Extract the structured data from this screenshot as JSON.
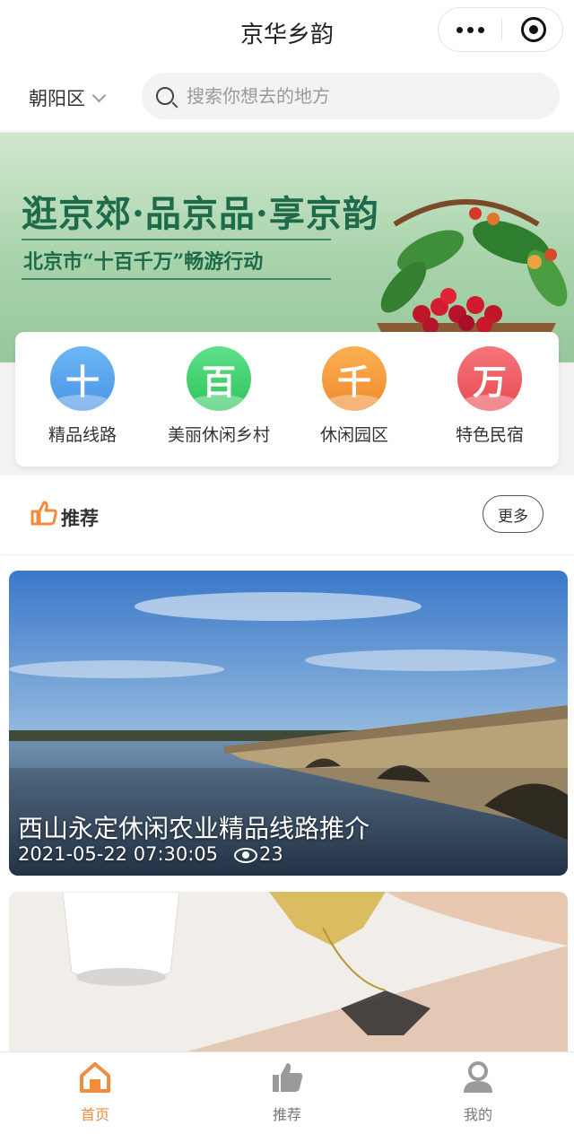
{
  "app": {
    "title": "京华乡韵"
  },
  "location": {
    "district": "朝阳区"
  },
  "search": {
    "placeholder": "搜索你想去的地方"
  },
  "banner": {
    "title": "逛京郊·品京品·享京韵",
    "subtitle": "北京市“十百千万”畅游行动"
  },
  "quick_links": [
    {
      "label": "精品线路",
      "glyph": "十",
      "color": "#5aa7f0"
    },
    {
      "label": "美丽休闲乡村",
      "glyph": "百",
      "color": "#3fcf6a"
    },
    {
      "label": "休闲园区",
      "glyph": "千",
      "color": "#f59a3c"
    },
    {
      "label": "特色民宿",
      "glyph": "万",
      "color": "#ee5d60"
    }
  ],
  "recommend": {
    "title": "推荐",
    "more_label": "更多"
  },
  "articles": [
    {
      "title": "西山永定休闲农业精品线路推介",
      "date": "2021-05-22 07:30:05",
      "views": "23"
    }
  ],
  "tabbar": [
    {
      "label": "首页",
      "icon": "home-icon",
      "active": true
    },
    {
      "label": "推荐",
      "icon": "thumbs-up-icon",
      "active": false
    },
    {
      "label": "我的",
      "icon": "user-icon",
      "active": false
    }
  ],
  "colors": {
    "accent": "#f28b3b",
    "banner_text": "#1d6b4a"
  }
}
